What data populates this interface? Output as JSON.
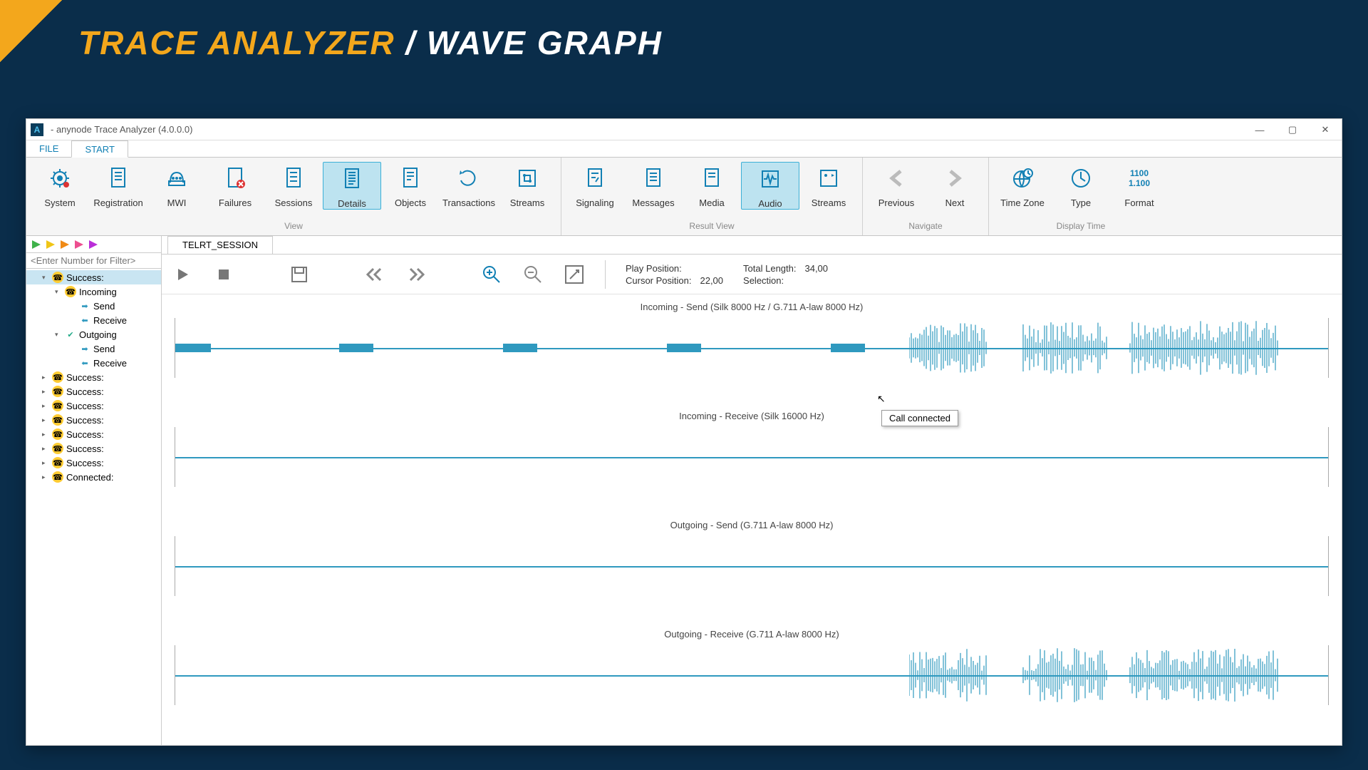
{
  "banner": {
    "main": "TRACE ANALYZER",
    "sep": "/",
    "sub": "WAVE GRAPH"
  },
  "window": {
    "title": " - anynode Trace Analyzer (4.0.0.0)",
    "app_icon": "A"
  },
  "menubar": {
    "file": "FILE",
    "start": "START"
  },
  "ribbon": {
    "groups": {
      "view": {
        "label": "View",
        "items": [
          {
            "name": "system",
            "label": "System"
          },
          {
            "name": "registration",
            "label": "Registration"
          },
          {
            "name": "mwi",
            "label": "MWI"
          },
          {
            "name": "failures",
            "label": "Failures"
          },
          {
            "name": "sessions",
            "label": "Sessions"
          },
          {
            "name": "details",
            "label": "Details",
            "active": true
          },
          {
            "name": "objects",
            "label": "Objects"
          },
          {
            "name": "transactions",
            "label": "Transactions"
          },
          {
            "name": "streams",
            "label": "Streams"
          }
        ]
      },
      "result": {
        "label": "Result View",
        "items": [
          {
            "name": "signaling",
            "label": "Signaling"
          },
          {
            "name": "messages",
            "label": "Messages"
          },
          {
            "name": "media",
            "label": "Media"
          },
          {
            "name": "audio",
            "label": "Audio",
            "active": true
          },
          {
            "name": "streams2",
            "label": "Streams"
          }
        ]
      },
      "nav": {
        "label": "Navigate",
        "items": [
          {
            "name": "previous",
            "label": "Previous"
          },
          {
            "name": "next",
            "label": "Next"
          }
        ]
      },
      "display": {
        "label": "Display Time",
        "items": [
          {
            "name": "timezone",
            "label": "Time Zone"
          },
          {
            "name": "type",
            "label": "Type"
          },
          {
            "name": "format",
            "label": "Format",
            "line1": "1100",
            "line2": "1.100"
          }
        ]
      }
    }
  },
  "sidebar": {
    "filter_placeholder": "<Enter Number for Filter>",
    "flags": [
      "#3fb24a",
      "#f0c516",
      "#f08a16",
      "#ed4e8f",
      "#ba2ed8"
    ],
    "tree": [
      {
        "label": "Success:",
        "level": 1,
        "kind": "session",
        "expanded": true,
        "selected": true
      },
      {
        "label": "Incoming",
        "level": 2,
        "kind": "dir",
        "expanded": true
      },
      {
        "label": "Send",
        "level": 3,
        "kind": "send"
      },
      {
        "label": "Receive",
        "level": 3,
        "kind": "recv"
      },
      {
        "label": "Outgoing",
        "level": 2,
        "kind": "dir-check",
        "expanded": true
      },
      {
        "label": "Send",
        "level": 3,
        "kind": "send"
      },
      {
        "label": "Receive",
        "level": 3,
        "kind": "recv"
      },
      {
        "label": "Success:",
        "level": 1,
        "kind": "session",
        "collapsed": true
      },
      {
        "label": "Success:",
        "level": 1,
        "kind": "session",
        "collapsed": true
      },
      {
        "label": "Success:",
        "level": 1,
        "kind": "session",
        "collapsed": true
      },
      {
        "label": "Success:",
        "level": 1,
        "kind": "session",
        "collapsed": true
      },
      {
        "label": "Success:",
        "level": 1,
        "kind": "session",
        "collapsed": true
      },
      {
        "label": "Success:",
        "level": 1,
        "kind": "session",
        "collapsed": true
      },
      {
        "label": "Success:",
        "level": 1,
        "kind": "session",
        "collapsed": true
      },
      {
        "label": "Connected:",
        "level": 1,
        "kind": "session",
        "collapsed": true
      }
    ]
  },
  "session_tab": "TELRT_SESSION",
  "playback": {
    "play_position_label": "Play Position:",
    "play_position_value": "",
    "cursor_position_label": "Cursor Position:",
    "cursor_position_value": "22,00",
    "total_length_label": "Total Length:",
    "total_length_value": "34,00",
    "selection_label": "Selection:",
    "selection_value": ""
  },
  "tooltip": "Call connected",
  "tracks": [
    {
      "label": "Incoming - Send (Silk 8000 Hz / G.711 A-law 8000 Hz)",
      "bursts": true,
      "wave": true
    },
    {
      "label": "Incoming - Receive (Silk 16000 Hz)",
      "flat": true
    },
    {
      "label": "Outgoing - Send (G.711 A-law 8000 Hz)",
      "flat": true
    },
    {
      "label": "Outgoing - Receive (G.711 A-law 8000 Hz)",
      "wave": true
    }
  ]
}
